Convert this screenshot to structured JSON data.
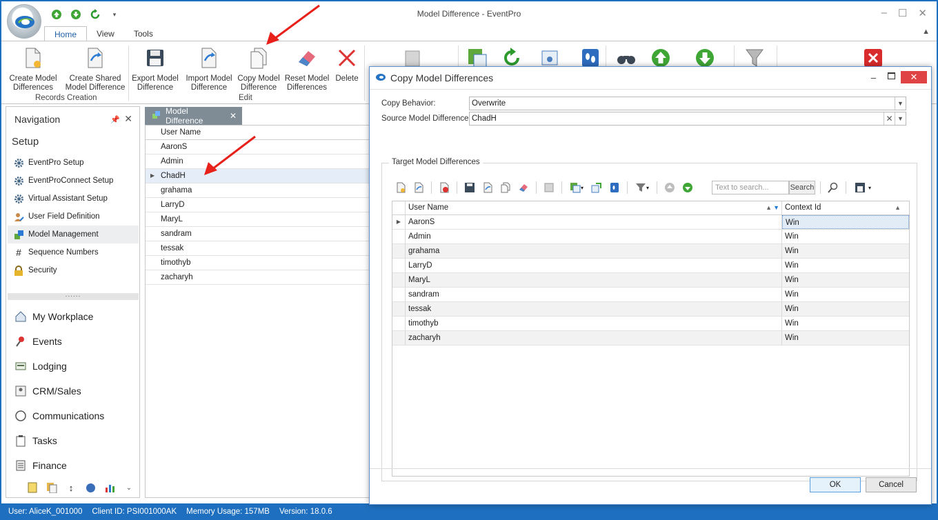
{
  "window": {
    "title": "Model Difference - EventPro"
  },
  "ribbon": {
    "tabs": [
      "Home",
      "View",
      "Tools"
    ],
    "buttons": {
      "create_model": "Create Model\nDifferences",
      "create_shared": "Create Shared\nModel Difference",
      "export_model": "Export Model\nDifference",
      "import_model": "Import Model\nDifference",
      "copy_model": "Copy Model\nDifference",
      "reset_model": "Reset Model\nDifferences",
      "delete": "Delete"
    },
    "groups": {
      "records_creation": "Records Creation",
      "edit": "Edit"
    }
  },
  "navigation": {
    "title": "Navigation",
    "section": "Setup",
    "setup_items": [
      "EventPro Setup",
      "EventProConnect Setup",
      "Virtual Assistant Setup",
      "User Field Definition",
      "Model Management",
      "Sequence Numbers",
      "Security"
    ],
    "splitter": "......",
    "modules": [
      "My Workplace",
      "Events",
      "Lodging",
      "CRM/Sales",
      "Communications",
      "Tasks",
      "Finance"
    ]
  },
  "main_tab": {
    "label": "Model Difference"
  },
  "main_grid": {
    "column": "User Name",
    "rows": [
      "AaronS",
      "Admin",
      "ChadH",
      "grahama",
      "LarryD",
      "MaryL",
      "sandram",
      "tessak",
      "timothyb",
      "zacharyh"
    ],
    "selected": "ChadH"
  },
  "status_bar": {
    "user": "User: AliceK_001000",
    "client": "Client ID: PSI001000AK",
    "memory": "Memory Usage: 157MB",
    "version": "Version: 18.0.6"
  },
  "dialog": {
    "title": "Copy Model Differences",
    "copy_behavior_label": "Copy Behavior:",
    "copy_behavior_value": "Overwrite",
    "source_label": "Source Model Difference:",
    "source_value": "ChadH",
    "group_title": "Target Model Differences",
    "search_placeholder": "Text to search...",
    "search_button": "Search",
    "columns": [
      "User Name",
      "Context Id"
    ],
    "rows": [
      {
        "user": "AaronS",
        "context": "Win"
      },
      {
        "user": "Admin",
        "context": "Win"
      },
      {
        "user": "grahama",
        "context": "Win"
      },
      {
        "user": "LarryD",
        "context": "Win"
      },
      {
        "user": "MaryL",
        "context": "Win"
      },
      {
        "user": "sandram",
        "context": "Win"
      },
      {
        "user": "tessak",
        "context": "Win"
      },
      {
        "user": "timothyb",
        "context": "Win"
      },
      {
        "user": "zacharyh",
        "context": "Win"
      }
    ],
    "ok": "OK",
    "cancel": "Cancel"
  },
  "colors": {
    "accent": "#1e6fbf",
    "annotation_arrow": "#e8201a"
  }
}
